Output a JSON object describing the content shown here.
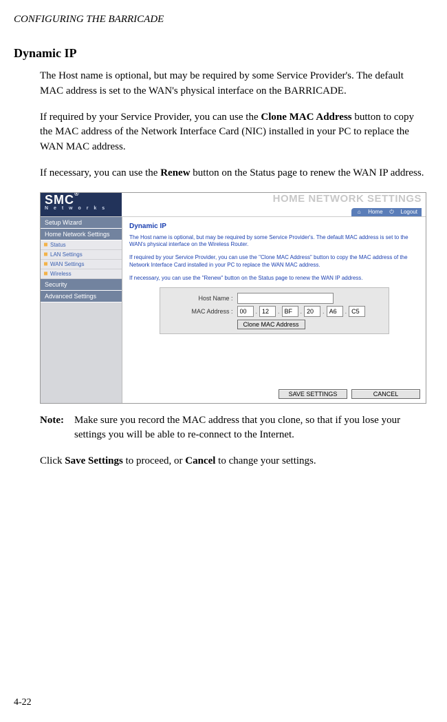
{
  "running_header": "CONFIGURING THE BARRICADE",
  "section_title": "Dynamic IP",
  "para1": "The Host name is optional, but may be required by some Service Provider's. The default MAC address is set to the WAN's physical interface on the BARRICADE.",
  "para2_a": "If required by your Service Provider, you can use the ",
  "para2_bold": "Clone MAC Address",
  "para2_b": " button to copy the MAC address of the Network Interface Card (NIC) installed in your PC to replace the WAN MAC address.",
  "para3_a": "If necessary, you can use the ",
  "para3_bold": "Renew",
  "para3_b": " button on the Status page to renew the WAN IP address.",
  "note_label": "Note:",
  "note_text": "Make sure you record the MAC address that you clone, so that if you lose your settings you will be able to re-connect to the Internet.",
  "closing_a": "Click ",
  "closing_bold1": "Save Settings",
  "closing_b": " to proceed, or ",
  "closing_bold2": "Cancel",
  "closing_c": " to change your settings.",
  "page_number": "4-22",
  "screenshot": {
    "logo_brand": "SMC",
    "logo_reg": "®",
    "logo_sub": "N e t w o r k s",
    "banner_title": "HOME NETWORK SETTINGS",
    "home": "Home",
    "logout": "Logout",
    "nav": {
      "setup_wizard": "Setup Wizard",
      "home_net": "Home Network Settings",
      "status": "Status",
      "lan": "LAN Settings",
      "wan": "WAN Settings",
      "wireless": "Wireless",
      "security": "Security",
      "advanced": "Advanced Settings"
    },
    "panel": {
      "title": "Dynamic IP",
      "p1": "The Host name is optional, but may be required by some Service Provider's. The default MAC address is set to the WAN's physical interface on the Wireless Router.",
      "p2": "If required by your Service Provider, you can use the \"Clone MAC Address\" button to copy the MAC address of the Network Interface Card installed in your PC to replace the WAN MAC address.",
      "p3": "If necessary, you can use the \"Renew\" button on the Status page to renew the WAN IP address.",
      "host_label": "Host Name :",
      "host_value": "",
      "mac_label": "MAC Address :",
      "mac": [
        "00",
        "12",
        "BF",
        "20",
        "A6",
        "C5"
      ],
      "clone_btn": "Clone MAC Address",
      "save_btn": "SAVE SETTINGS",
      "cancel_btn": "CANCEL"
    }
  }
}
